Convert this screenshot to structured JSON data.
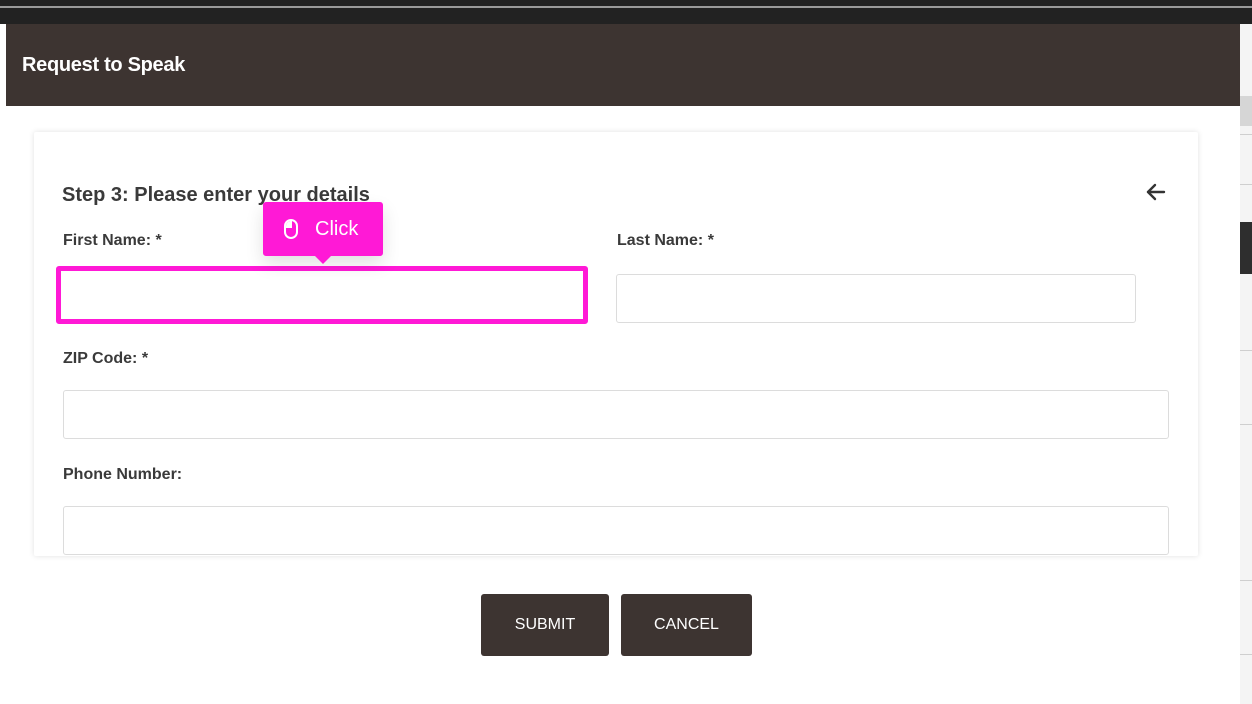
{
  "dialog": {
    "title": "Request to Speak"
  },
  "form": {
    "step_title": "Step 3: Please enter your details",
    "back_icon": "arrow-left-icon",
    "fields": {
      "first_name": {
        "label": "First Name: *",
        "value": "",
        "placeholder": ""
      },
      "last_name": {
        "label": "Last Name: *",
        "value": "",
        "placeholder": ""
      },
      "zip_code": {
        "label": "ZIP Code: *",
        "value": "",
        "placeholder": ""
      },
      "phone_number": {
        "label": "Phone Number:",
        "value": "",
        "placeholder": ""
      }
    }
  },
  "buttons": {
    "submit_label": "SUBMIT",
    "cancel_label": "CANCEL"
  },
  "annotation": {
    "tooltip_label": "Click",
    "tooltip_icon": "mouse-icon",
    "color": "#ff19d6"
  },
  "colors": {
    "header_bg": "#3d3431",
    "button_bg": "#3d3431",
    "text": "#3a3a3a"
  }
}
